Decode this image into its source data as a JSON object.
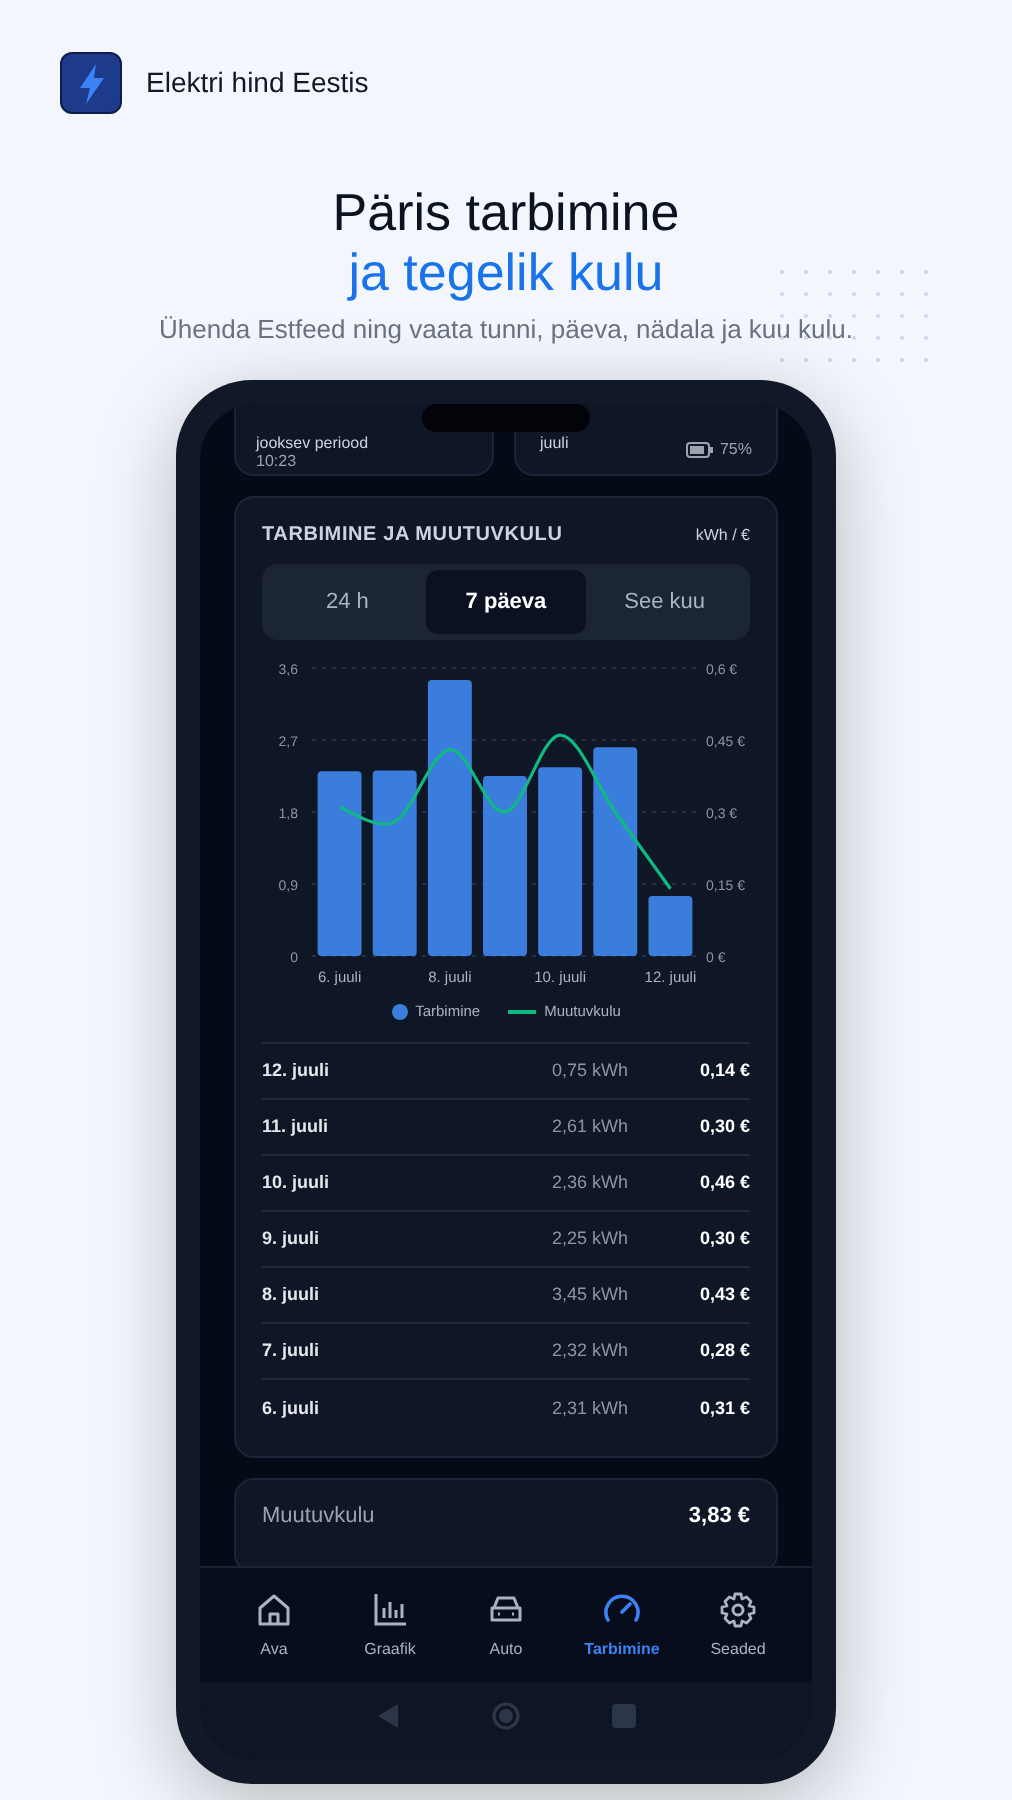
{
  "app": {
    "name": "Elektri hind Eestis"
  },
  "headline": {
    "line_1": "Päris tarbimine",
    "line_2": "ja tegelik kulu",
    "subtitle": "Ühenda Estfeed ning vaata tunni, päeva, nädala ja kuu kulu."
  },
  "status_bar": {
    "time": "10:23",
    "battery": "75%"
  },
  "top_cards": [
    {
      "label": "jooksev periood"
    },
    {
      "label": "juuli"
    }
  ],
  "card": {
    "title": "TARBIMINE JA MUUTUVKULU",
    "unit": "kWh / €",
    "tabs": [
      {
        "label": "24 h",
        "selected": false
      },
      {
        "label": "7 päeva",
        "selected": true
      },
      {
        "label": "See kuu",
        "selected": false
      }
    ],
    "chart_data": {
      "type": "bar",
      "grid": true,
      "x": [
        6,
        7,
        8,
        9,
        10,
        11,
        12
      ],
      "xlim": [
        5.5,
        12.5
      ],
      "xticks": [
        {
          "value": 6,
          "label": "6. juuli"
        },
        {
          "value": 8,
          "label": "8. juuli"
        },
        {
          "value": 10,
          "label": "10. juuli"
        },
        {
          "value": 12,
          "label": "12. juuli"
        }
      ],
      "ylim": [
        0,
        3.6
      ],
      "yticks": [
        {
          "value": 0,
          "label": "0"
        },
        {
          "value": 0.9,
          "label": "0,9"
        },
        {
          "value": 1.8,
          "label": "1,8"
        },
        {
          "value": 2.7,
          "label": "2,7"
        },
        {
          "value": 3.6,
          "label": "3,6"
        }
      ],
      "y2lim": [
        0,
        0.6
      ],
      "y2ticks": [
        {
          "value": 0,
          "label": "0 €"
        },
        {
          "value": 0.15,
          "label": "0,15 €"
        },
        {
          "value": 0.3,
          "label": "0,3 €"
        },
        {
          "value": 0.45,
          "label": "0,45 €"
        },
        {
          "value": 0.6,
          "label": "0,6 €"
        }
      ],
      "series": [
        {
          "name": "Tarbimine",
          "color": "#3b7ddd",
          "values": [
            2.31,
            2.32,
            3.45,
            2.25,
            2.36,
            2.61,
            0.75
          ]
        },
        {
          "name": "Muutuvkulu",
          "type": "line",
          "axis": "y2",
          "color": "#10b981",
          "values": [
            0.31,
            0.28,
            0.43,
            0.3,
            0.46,
            0.3,
            0.14
          ]
        }
      ]
    },
    "rows": [
      {
        "date": "12. juuli",
        "kwh": "0,75 kWh",
        "cost": "0,14 €"
      },
      {
        "date": "11. juuli",
        "kwh": "2,61 kWh",
        "cost": "0,30 €"
      },
      {
        "date": "10. juuli",
        "kwh": "2,36 kWh",
        "cost": "0,46 €"
      },
      {
        "date": "9. juuli",
        "kwh": "2,25 kWh",
        "cost": "0,30 €"
      },
      {
        "date": "8. juuli",
        "kwh": "3,45 kWh",
        "cost": "0,43 €"
      },
      {
        "date": "7. juuli",
        "kwh": "2,32 kWh",
        "cost": "0,28 €"
      },
      {
        "date": "6. juuli",
        "kwh": "2,31 kWh",
        "cost": "0,31 €"
      }
    ]
  },
  "total": {
    "label": "Muutuvkulu",
    "value": "3,83 €"
  },
  "nav": [
    {
      "kind": "home",
      "label": "Ava",
      "selected": false
    },
    {
      "kind": "chart",
      "label": "Graafik",
      "selected": false
    },
    {
      "kind": "car",
      "label": "Auto",
      "selected": false
    },
    {
      "kind": "gauge",
      "label": "Tarbimine",
      "selected": true
    },
    {
      "kind": "gear",
      "label": "Seaded",
      "selected": false
    }
  ]
}
